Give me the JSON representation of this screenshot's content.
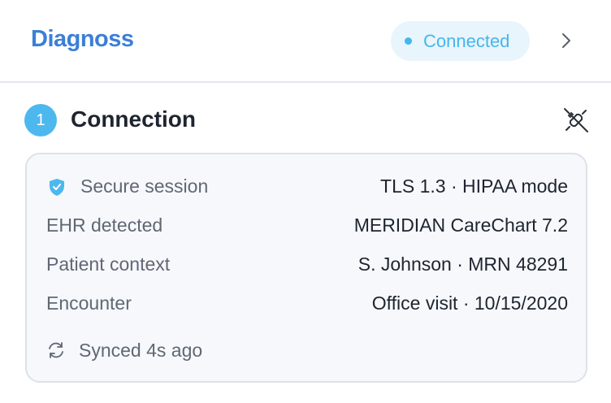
{
  "header": {
    "logo_text": "Diagnoss",
    "status": {
      "label": "Connected",
      "color": "#45b6ee"
    }
  },
  "section": {
    "step_number": "1",
    "title": "Connection",
    "icons": [
      "unplug-icon",
      "chevron-right-icon"
    ]
  },
  "connection": {
    "rows": [
      {
        "label": "Secure session",
        "value": "TLS 1.3 · HIPAA mode",
        "icon": "shield-check-icon"
      },
      {
        "label": "EHR detected",
        "value": "MERIDIAN CareChart 7.2"
      },
      {
        "label": "Patient context",
        "value": "S. Johnson · MRN 48291"
      },
      {
        "label": "Encounter",
        "value": "Office visit · 10/15/2020"
      }
    ],
    "sync_text": "Synced 4s ago"
  },
  "colors": {
    "accent": "#45b6ee",
    "brand": "#3b7fd6",
    "badge": "#4db8ee"
  }
}
